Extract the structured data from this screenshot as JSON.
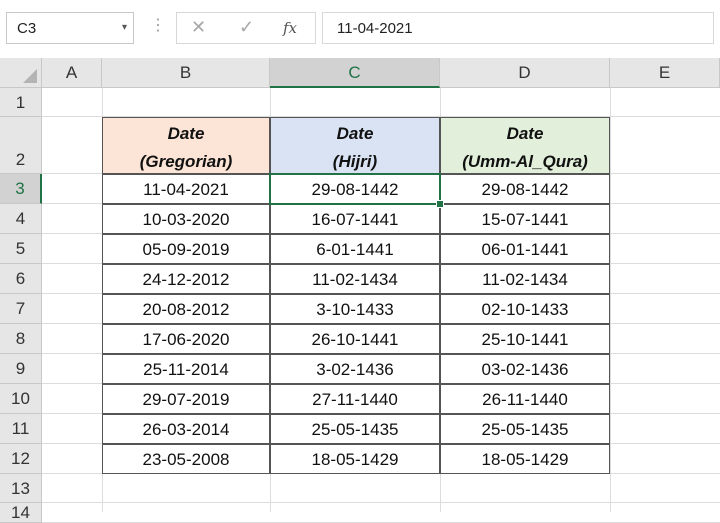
{
  "formula_bar": {
    "name_box": "C3",
    "name_box_arrow": "▾",
    "separator": "⋮",
    "cancel_glyph": "✕",
    "enter_glyph": "✓",
    "function_glyph": "fx",
    "formula_value": "11-04-2021"
  },
  "columns": [
    "A",
    "B",
    "C",
    "D",
    "E"
  ],
  "rows": [
    "1",
    "2",
    "3",
    "4",
    "5",
    "6",
    "7",
    "8",
    "9",
    "10",
    "11",
    "12",
    "13",
    "14"
  ],
  "active_cell": "C3",
  "table": {
    "headers": [
      {
        "line1": "Date",
        "line2": "(Gregorian)",
        "fill": "#fce4d6"
      },
      {
        "line1": "Date",
        "line2": "(Hijri)",
        "fill": "#dae3f3"
      },
      {
        "line1": "Date",
        "line2": "(Umm-Al_Qura)",
        "fill": "#e2efda"
      }
    ],
    "rows": [
      [
        "11-04-2021",
        "29-08-1442",
        "29-08-1442"
      ],
      [
        "10-03-2020",
        "16-07-1441",
        "15-07-1441"
      ],
      [
        "05-09-2019",
        "6-01-1441",
        "06-01-1441"
      ],
      [
        "24-12-2012",
        "11-02-1434",
        "11-02-1434"
      ],
      [
        "20-08-2012",
        "3-10-1433",
        "02-10-1433"
      ],
      [
        "17-06-2020",
        "26-10-1441",
        "25-10-1441"
      ],
      [
        "25-11-2014",
        "3-02-1436",
        "03-02-1436"
      ],
      [
        "29-07-2019",
        "27-11-1440",
        "26-11-1440"
      ],
      [
        "26-03-2014",
        "25-05-1435",
        "25-05-1435"
      ],
      [
        "23-05-2008",
        "18-05-1429",
        "18-05-1429"
      ]
    ]
  },
  "colors": {
    "accent": "#217346",
    "header_bg": "#e6e6e6",
    "gridline": "#dcdcdc"
  }
}
